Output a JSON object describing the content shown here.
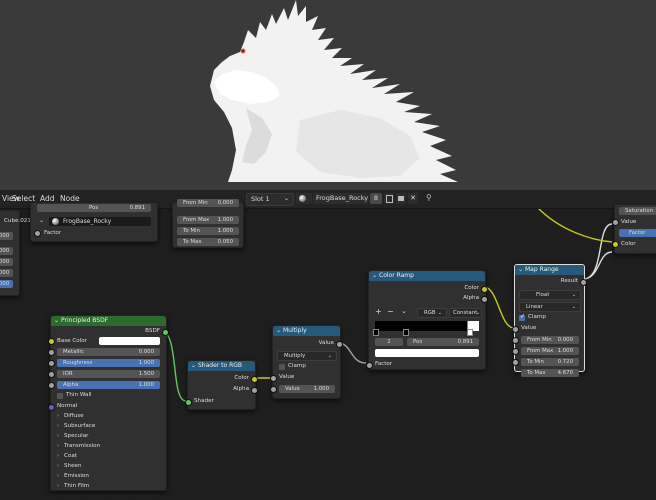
{
  "header": {
    "menu": [
      "View",
      "Select",
      "Add",
      "Node"
    ],
    "slot": "Slot 1",
    "material": "FrogBase_Rocky",
    "user_count": "8"
  },
  "left_partial": {
    "object": "Cube.021",
    "factor": "Factor",
    "values": [
      "000",
      "000",
      "000",
      "000",
      "000"
    ]
  },
  "material_node": {
    "left_field": "Pos",
    "right_field": "0.891",
    "name": "FrogBase_Rocky"
  },
  "top_map_range": {
    "rows": [
      {
        "label": "From Min",
        "value": "0.000"
      },
      {
        "label": "From Max",
        "value": "1.000"
      },
      {
        "label": "To Min",
        "value": "1.000"
      },
      {
        "label": "To Max",
        "value": "0.050"
      }
    ]
  },
  "hsv_partial": {
    "saturation": "Saturation",
    "value": "Value",
    "factor": "Factor",
    "color": "Color"
  },
  "bsdf": {
    "title": "Principled BSDF",
    "output": "BSDF",
    "base_color": "Base Color",
    "fields": [
      {
        "label": "Metallic",
        "value": "0.000",
        "sel": false
      },
      {
        "label": "Roughness",
        "value": "1.000",
        "sel": true
      },
      {
        "label": "IOR",
        "value": "1.500",
        "sel": false
      },
      {
        "label": "Alpha",
        "value": "1.000",
        "sel": true
      }
    ],
    "thin_wall": "Thin Wall",
    "normal": "Normal",
    "panels": [
      "Diffuse",
      "Subsurface",
      "Specular",
      "Transmission",
      "Coat",
      "Sheen",
      "Emission",
      "Thin Film"
    ]
  },
  "shader_to_rgb": {
    "title": "Shader to RGB",
    "color": "Color",
    "alpha": "Alpha",
    "shader": "Shader"
  },
  "multiply": {
    "title": "Multiply",
    "output": "Value",
    "operation": "Multiply",
    "clamp": "Clamp",
    "value_in": "Value",
    "value_label": "Value",
    "value_num": "1.000"
  },
  "color_ramp": {
    "title": "Color Ramp",
    "color": "Color",
    "alpha": "Alpha",
    "plus": "+",
    "minus": "−",
    "mode": "RGB",
    "interp": "Constant",
    "index": "2",
    "pos_label": "Pos",
    "pos_value": "0.891",
    "fac": "Factor"
  },
  "map_range": {
    "title": "Map Range",
    "result": "Result",
    "type": "Float",
    "interp": "Linear",
    "clamp": "Clamp",
    "value": "Value",
    "rows": [
      {
        "label": "From Min",
        "value": "0.000"
      },
      {
        "label": "From Max",
        "value": "1.000"
      },
      {
        "label": "To Min",
        "value": "0.720"
      },
      {
        "label": "To Max",
        "value": "4.670"
      }
    ]
  }
}
